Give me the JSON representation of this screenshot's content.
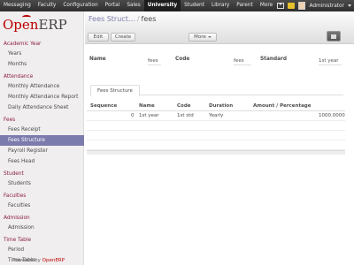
{
  "topmenu": {
    "items": [
      {
        "label": "Messaging"
      },
      {
        "label": "Faculty"
      },
      {
        "label": "Configuration"
      },
      {
        "label": "Portal"
      },
      {
        "label": "Sales"
      },
      {
        "label": "University"
      },
      {
        "label": "Student"
      },
      {
        "label": "Library"
      },
      {
        "label": "Parent"
      },
      {
        "label": "More"
      }
    ],
    "user": "Administrator"
  },
  "logo": {
    "part1": "Open",
    "part2": "ERP"
  },
  "sidebar": {
    "sections": [
      {
        "title": "Academic Year",
        "links": [
          "Years",
          "Months"
        ]
      },
      {
        "title": "Attendance",
        "links": [
          "Monthly Attendance",
          "Monthly Attendance Report",
          "Daily Attendance Sheet"
        ]
      },
      {
        "title": "Fees",
        "links": [
          "Fees Receipt",
          "Fees Structure",
          "Payroll Register",
          "Fees Head"
        ]
      },
      {
        "title": "Student",
        "links": [
          "Students"
        ]
      },
      {
        "title": "Faculties",
        "links": [
          "Faculties"
        ]
      },
      {
        "title": "Admission",
        "links": [
          "Admission"
        ]
      },
      {
        "title": "Time Table",
        "links": [
          "Period",
          "Time Table"
        ]
      }
    ],
    "powered_by": "Powered by ",
    "powered_brand": "OpenERP"
  },
  "breadcrumb": {
    "parent": "Fees Struct…",
    "separator": "/",
    "current": "fees"
  },
  "buttons": {
    "edit": "Edit",
    "create": "Create",
    "more": "More"
  },
  "form": {
    "name_label": "Name",
    "name_value": "fees",
    "code_label": "Code",
    "code_value": "fees",
    "standard_label": "Standard",
    "standard_value": "1st year"
  },
  "tab": {
    "label": "Fees Structure"
  },
  "table": {
    "columns": [
      "Sequence",
      "Name",
      "Code",
      "Duration",
      "Amount / Percentage"
    ],
    "rows": [
      {
        "sequence": "0",
        "name": "1st year",
        "code": "1st std",
        "duration": "Yearly",
        "amount": "1000.0000"
      }
    ]
  },
  "colors": {
    "accent": "#7c7bad",
    "brand": "#bb0000",
    "section": "#8c1d48"
  }
}
